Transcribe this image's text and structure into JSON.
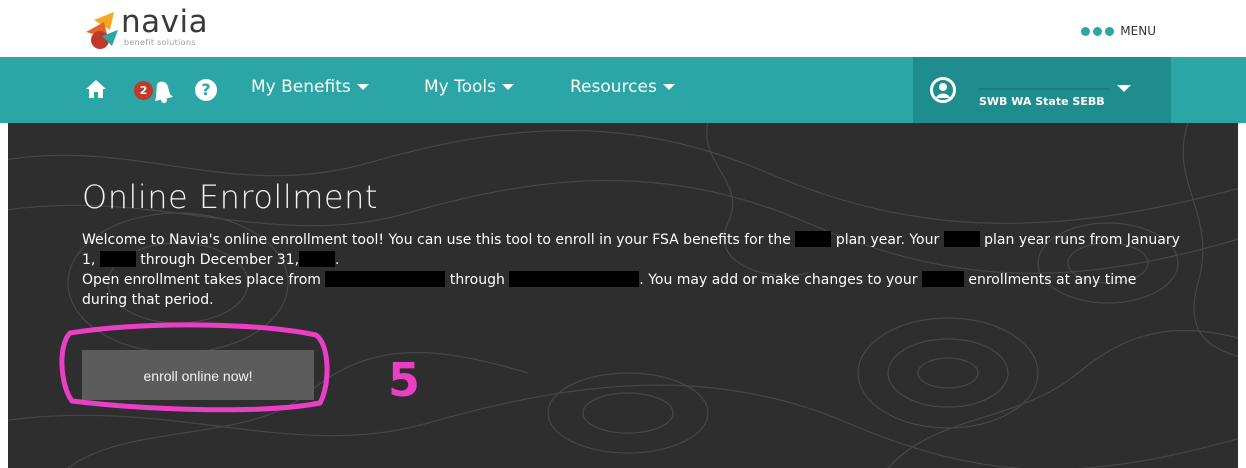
{
  "brand": {
    "name": "navia",
    "tagline": "benefit solutions"
  },
  "menu": {
    "label": "MENU"
  },
  "nav": {
    "notification_count": "2",
    "help_symbol": "?",
    "links": [
      {
        "label": "My Benefits"
      },
      {
        "label": "My Tools"
      },
      {
        "label": "Resources"
      }
    ]
  },
  "user": {
    "org": "SWB WA State SEBB"
  },
  "hero": {
    "title": "Online Enrollment",
    "p1_a": "Welcome to Navia's online enrollment tool! You can use this tool to enroll in your FSA benefits for the",
    "p1_b": "plan year. Your",
    "p1_c": "plan year runs from January 1,",
    "p1_d": "through December 31,",
    "p1_e": ".",
    "p2_a": "Open enrollment takes place from",
    "p2_b": "through",
    "p2_c": ". You may add or make changes to your",
    "p2_d": "enrollments at any time during that period.",
    "button_label": "enroll online now!"
  },
  "annotation": {
    "number": "5"
  },
  "colors": {
    "teal": "#2ba5a5",
    "teal_dark": "#1f8d8d",
    "hero_bg": "#2e2e2e",
    "button_bg": "#5c5c5c",
    "annotation_pink": "#ea3fc4"
  }
}
